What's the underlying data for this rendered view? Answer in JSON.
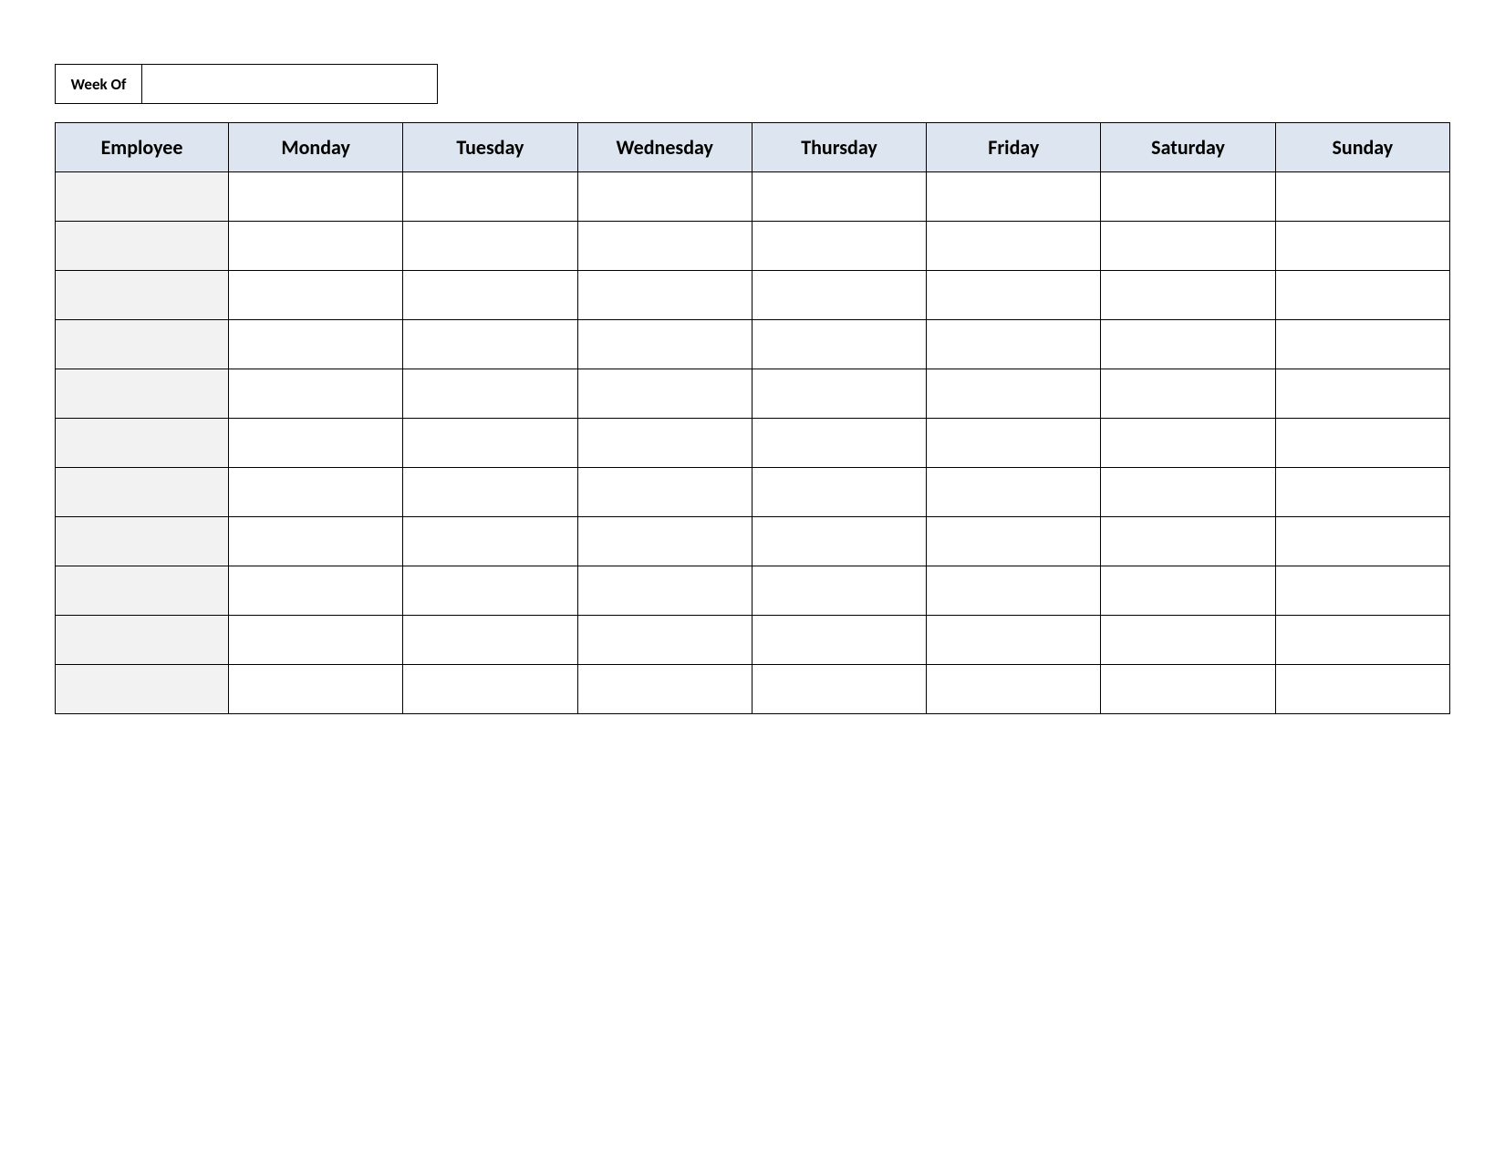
{
  "week_of_label": "Week Of",
  "week_of_value": "",
  "columns": [
    "Employee",
    "Monday",
    "Tuesday",
    "Wednesday",
    "Thursday",
    "Friday",
    "Saturday",
    "Sunday"
  ],
  "rows": [
    {
      "employee": "",
      "days": [
        "",
        "",
        "",
        "",
        "",
        "",
        ""
      ]
    },
    {
      "employee": "",
      "days": [
        "",
        "",
        "",
        "",
        "",
        "",
        ""
      ]
    },
    {
      "employee": "",
      "days": [
        "",
        "",
        "",
        "",
        "",
        "",
        ""
      ]
    },
    {
      "employee": "",
      "days": [
        "",
        "",
        "",
        "",
        "",
        "",
        ""
      ]
    },
    {
      "employee": "",
      "days": [
        "",
        "",
        "",
        "",
        "",
        "",
        ""
      ]
    },
    {
      "employee": "",
      "days": [
        "",
        "",
        "",
        "",
        "",
        "",
        ""
      ]
    },
    {
      "employee": "",
      "days": [
        "",
        "",
        "",
        "",
        "",
        "",
        ""
      ]
    },
    {
      "employee": "",
      "days": [
        "",
        "",
        "",
        "",
        "",
        "",
        ""
      ]
    },
    {
      "employee": "",
      "days": [
        "",
        "",
        "",
        "",
        "",
        "",
        ""
      ]
    },
    {
      "employee": "",
      "days": [
        "",
        "",
        "",
        "",
        "",
        "",
        ""
      ]
    },
    {
      "employee": "",
      "days": [
        "",
        "",
        "",
        "",
        "",
        "",
        ""
      ]
    }
  ]
}
